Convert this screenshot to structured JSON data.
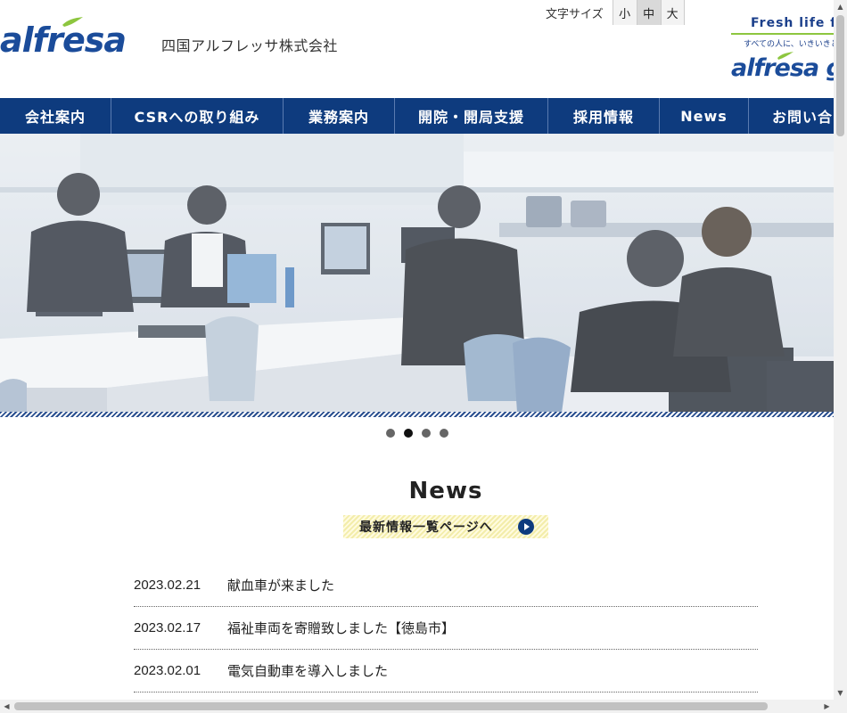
{
  "header": {
    "logo_text": "alfresa",
    "company_name": "四国アルフレッサ株式会社",
    "font_size": {
      "label": "文字サイズ",
      "options": [
        "小",
        "中",
        "大"
      ],
      "selected": "中"
    },
    "fresh": {
      "title": "Fresh life for",
      "subtitle": "すべての人に、いきいきと",
      "brand": "alfresa g"
    }
  },
  "nav": {
    "items": [
      "会社案内",
      "CSRへの取り組み",
      "業務案内",
      "開院・開局支援",
      "採用情報",
      "News",
      "お問い合"
    ]
  },
  "slider": {
    "dot_count": 4,
    "active_index": 1
  },
  "news": {
    "title": "News",
    "list_link": "最新情報一覧ページへ",
    "items": [
      {
        "date": "2023.02.21",
        "text": "献血車が来ました"
      },
      {
        "date": "2023.02.17",
        "text": "福祉車両を寄贈致しました【徳島市】"
      },
      {
        "date": "2023.02.01",
        "text": "電気自動車を導入しました"
      }
    ]
  },
  "colors": {
    "brand_blue": "#0e3b7e",
    "accent_green": "#8dc63f",
    "nav_bg": "#0e3b7e"
  },
  "icons": {
    "scroll_up": "triangle-up-icon",
    "scroll_down": "triangle-down-icon",
    "scroll_left": "triangle-left-icon",
    "scroll_right": "triangle-right-icon",
    "news_arrow": "circle-arrow-right-icon"
  }
}
